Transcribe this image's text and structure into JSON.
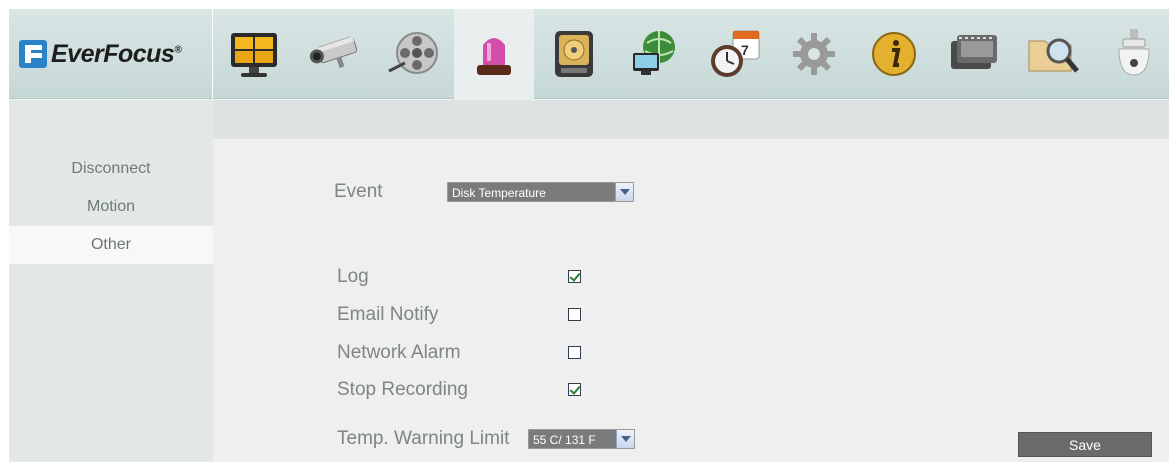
{
  "brand": {
    "name": "EverFocus",
    "mark": "®"
  },
  "toolbar": {
    "icons": [
      {
        "name": "live-view-icon"
      },
      {
        "name": "camera-icon"
      },
      {
        "name": "playback-reel-icon"
      },
      {
        "name": "alarm-siren-icon",
        "active": true
      },
      {
        "name": "hard-disk-icon"
      },
      {
        "name": "network-globe-icon"
      },
      {
        "name": "schedule-clock-icon"
      },
      {
        "name": "settings-gear-icon"
      },
      {
        "name": "info-icon"
      },
      {
        "name": "film-archive-icon"
      },
      {
        "name": "search-folder-icon"
      },
      {
        "name": "ptz-dome-icon"
      }
    ]
  },
  "sidebar": {
    "items": [
      {
        "label": "Disconnect"
      },
      {
        "label": "Motion"
      },
      {
        "label": "Other",
        "selected": true
      }
    ]
  },
  "form": {
    "event_label": "Event",
    "event_value": "Disk Temperature",
    "options": [
      {
        "label": "Log",
        "checked": true
      },
      {
        "label": "Email Notify",
        "checked": false
      },
      {
        "label": "Network Alarm",
        "checked": false
      },
      {
        "label": "Stop Recording",
        "checked": true
      }
    ],
    "temp_label": "Temp. Warning Limit",
    "temp_value": "55 C/ 131 F",
    "save_label": "Save"
  },
  "colors": {
    "header_bg": "#c6d8d6",
    "sidebar_bg": "#e1e8e6",
    "content_bg": "#efefef",
    "label_text": "#7d8684",
    "button_bg": "#6a6a6a"
  }
}
